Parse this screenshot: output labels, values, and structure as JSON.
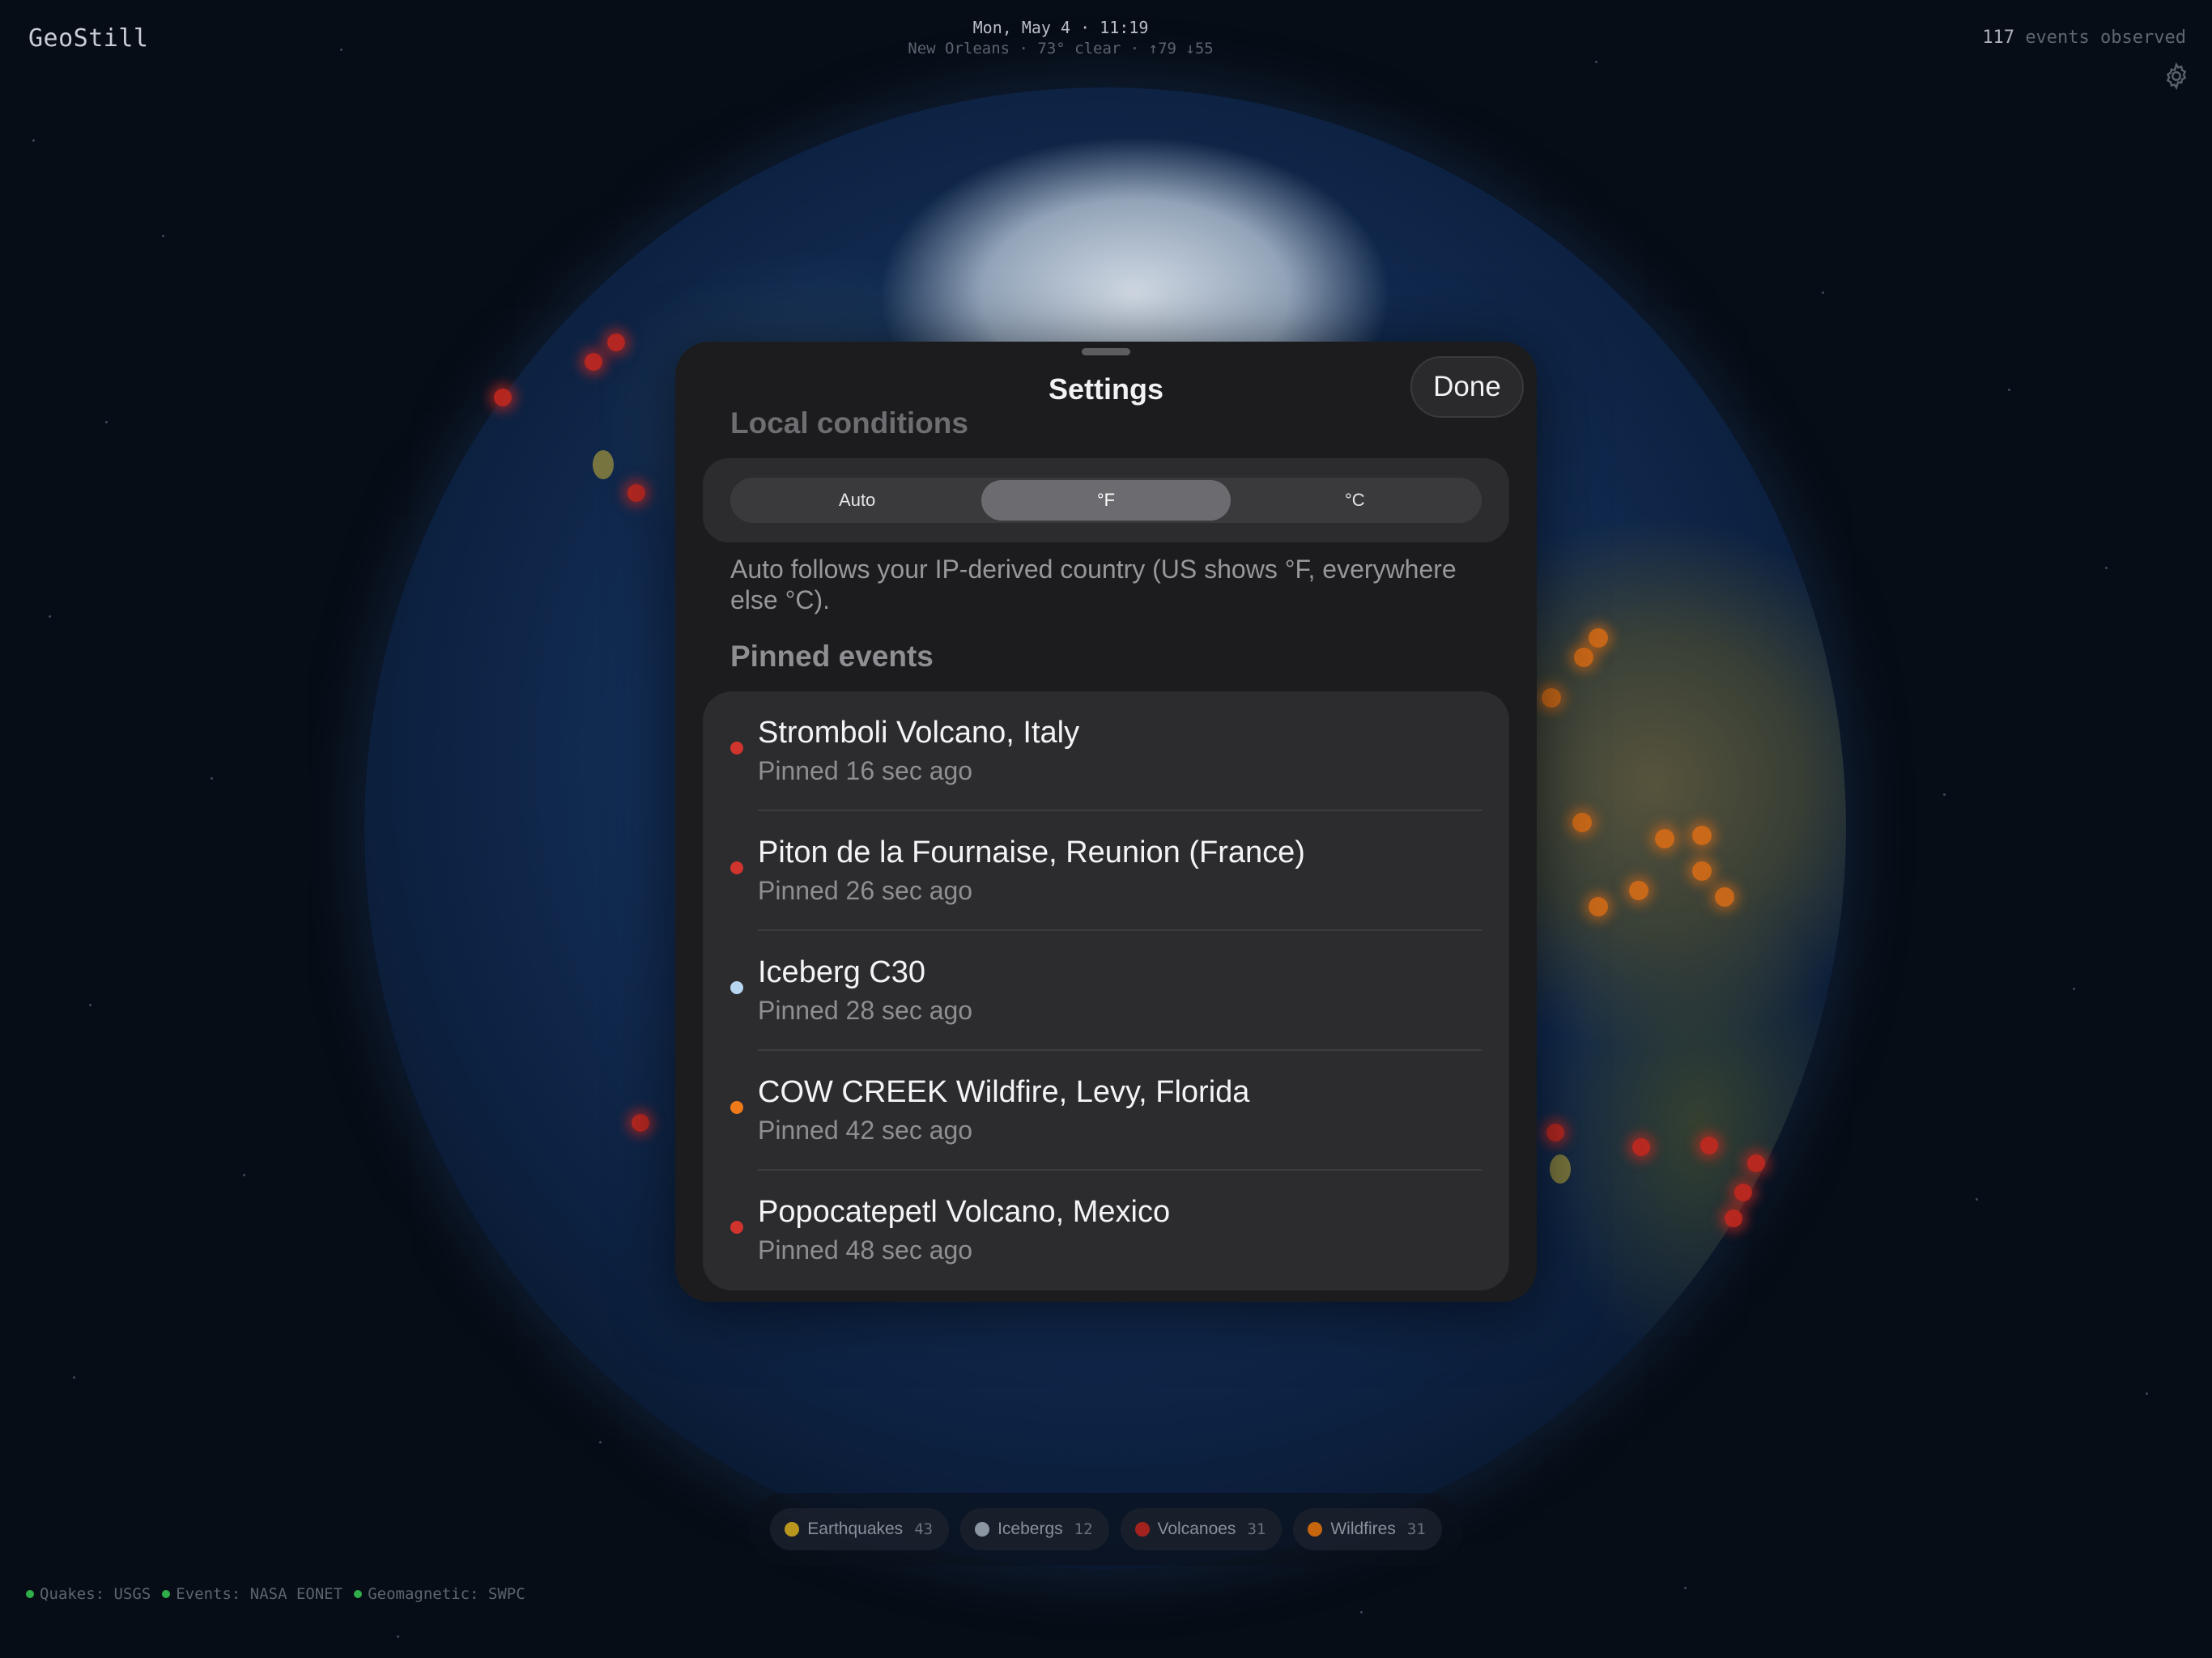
{
  "app": {
    "brand": "GeoStill",
    "clock": "Mon, May 4 · 11:19",
    "weather": "New Orleans · 73° clear · ↑79 ↓55",
    "events_count": "117",
    "events_label": "events observed"
  },
  "settings": {
    "title": "Settings",
    "done_label": "Done",
    "local_conditions_heading": "Local conditions",
    "units": {
      "options": [
        "Auto",
        "°F",
        "°C"
      ],
      "selected": "°F"
    },
    "units_help": "Auto follows your IP-derived country (US shows °F, everywhere else °C).",
    "pinned_heading": "Pinned events",
    "pinned": [
      {
        "title": "Stromboli Volcano, Italy",
        "subtitle": "Pinned 16 sec ago",
        "color": "#d0342c"
      },
      {
        "title": "Piton de la Fournaise, Reunion (France)",
        "subtitle": "Pinned 26 sec ago",
        "color": "#d0342c"
      },
      {
        "title": "Iceberg C30",
        "subtitle": "Pinned 28 sec ago",
        "color": "#b8d6f2"
      },
      {
        "title": "COW CREEK Wildfire, Levy, Florida",
        "subtitle": "Pinned 42 sec ago",
        "color": "#ef7a1a"
      },
      {
        "title": "Popocatepetl Volcano, Mexico",
        "subtitle": "Pinned 48 sec ago",
        "color": "#d0342c"
      }
    ]
  },
  "filters": [
    {
      "label": "Earthquakes",
      "count": "43",
      "color": "#b9971f"
    },
    {
      "label": "Icebergs",
      "count": "12",
      "color": "#8c96a3"
    },
    {
      "label": "Volcanoes",
      "count": "31",
      "color": "#a3221d"
    },
    {
      "label": "Wildfires",
      "count": "31",
      "color": "#c8650f"
    }
  ],
  "sources": [
    "Quakes: USGS",
    "Events: NASA EONET",
    "Geomagnetic: SWPC"
  ]
}
